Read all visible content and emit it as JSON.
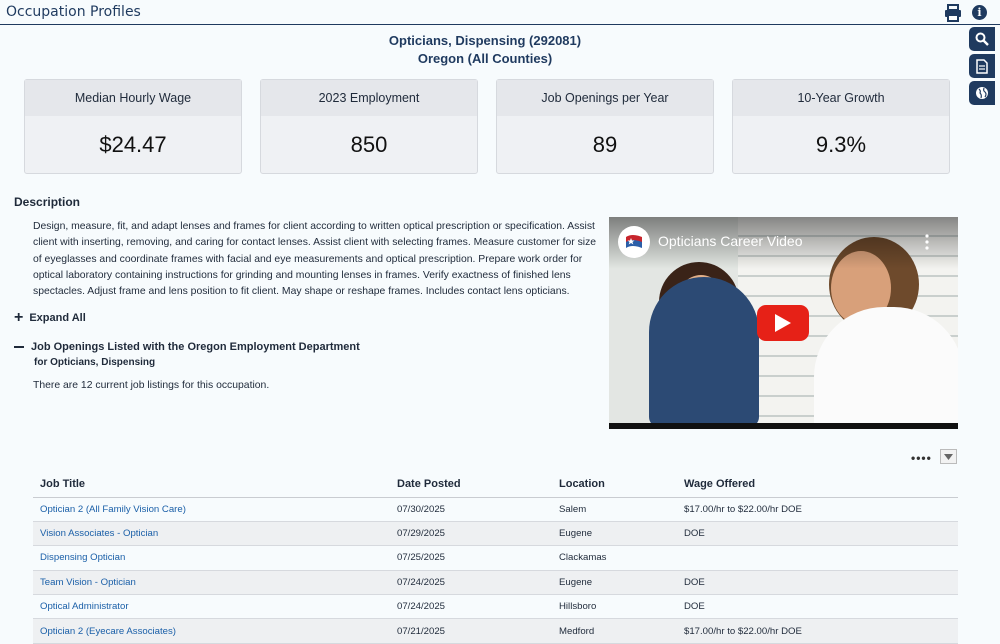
{
  "header": {
    "title": "Occupation Profiles"
  },
  "occupation": {
    "title": "Opticians, Dispensing (292081)",
    "region": "Oregon (All Counties)"
  },
  "stats": [
    {
      "label": "Median Hourly Wage",
      "value": "$24.47"
    },
    {
      "label": "2023 Employment",
      "value": "850"
    },
    {
      "label": "Job Openings per Year",
      "value": "89"
    },
    {
      "label": "10-Year Growth",
      "value": "9.3%"
    }
  ],
  "description": {
    "heading": "Description",
    "text": "Design, measure, fit, and adapt lenses and frames for client according to written optical prescription or specification. Assist client with inserting, removing, and caring for contact lenses. Assist client with selecting frames. Measure customer for size of eyeglasses and coordinate frames with facial and eye measurements and optical prescription. Prepare work order for optical laboratory containing instructions for grinding and mounting lenses in frames. Verify exactness of finished lens spectacles. Adjust frame and lens position to fit client. May shape or reshape frames. Includes contact lens opticians."
  },
  "expand_all": "Expand All",
  "job_openings": {
    "heading": "Job Openings Listed with the Oregon Employment Department",
    "subheading": "for Opticians, Dispensing",
    "count_text": "There are 12 current job listings for this occupation."
  },
  "video": {
    "title": "Opticians Career Video"
  },
  "table": {
    "columns": [
      "Job Title",
      "Date Posted",
      "Location",
      "Wage Offered"
    ],
    "rows": [
      {
        "title": "Optician 2 (All Family Vision Care)",
        "date": "07/30/2025",
        "location": "Salem",
        "wage": "$17.00/hr to $22.00/hr DOE"
      },
      {
        "title": "Vision Associates - Optician",
        "date": "07/29/2025",
        "location": "Eugene",
        "wage": "DOE"
      },
      {
        "title": "Dispensing Optician",
        "date": "07/25/2025",
        "location": "Clackamas",
        "wage": ""
      },
      {
        "title": "Team Vision - Optician",
        "date": "07/24/2025",
        "location": "Eugene",
        "wage": "DOE"
      },
      {
        "title": "Optical Administrator",
        "date": "07/24/2025",
        "location": "Hillsboro",
        "wage": "DOE"
      },
      {
        "title": "Optician 2 (Eyecare Associates)",
        "date": "07/21/2025",
        "location": "Medford",
        "wage": "$17.00/hr to $22.00/hr DOE"
      }
    ]
  },
  "icons": [
    "print-icon",
    "info-icon",
    "search-icon",
    "document-icon",
    "globe-icon",
    "play-icon",
    "more-vertical-icon",
    "plus-icon",
    "minus-icon",
    "more-horizontal-icon",
    "chevron-down-icon"
  ],
  "colors": {
    "brand_navy": "#1f3a5f",
    "link_blue": "#1a5fa8",
    "youtube_red": "#e62117"
  }
}
